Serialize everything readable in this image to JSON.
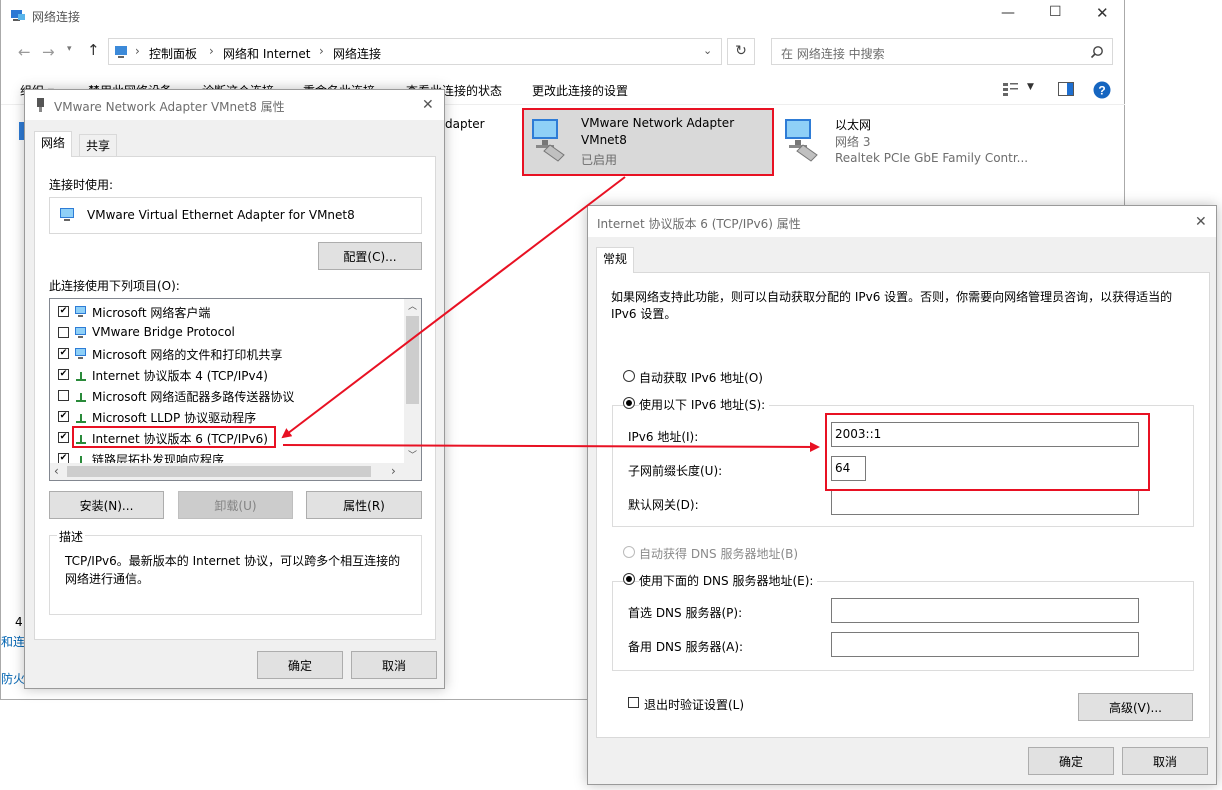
{
  "explorer": {
    "title": "网络连接",
    "breadcrumb": [
      "控制面板",
      "网络和 Internet",
      "网络连接"
    ],
    "search_placeholder": "在 网络连接 中搜索",
    "commands": [
      "组织 ▾",
      "禁用此网络设备",
      "诊断这个连接",
      "重命名此连接",
      "查看此连接的状态",
      "更改此连接的设置"
    ],
    "items": [
      {
        "name": "VMware Network Adapter VMnet8",
        "line1": "VMware Network Adapter",
        "line2": "VMnet8",
        "status": "已启用"
      },
      {
        "name": "以太网",
        "line1": "以太网",
        "line2": "网络 3",
        "status": "Realtek PCIe GbE Family Contr..."
      }
    ],
    "partial_item": "dapter",
    "left_fragments": [
      "4",
      "和连",
      "防火"
    ]
  },
  "props": {
    "title": "VMware Network Adapter VMnet8 属性",
    "tabs": [
      "网络",
      "共享"
    ],
    "connect_label": "连接时使用:",
    "adapter": "VMware Virtual Ethernet Adapter for VMnet8",
    "configure": "配置(C)...",
    "items_label": "此连接使用下列项目(O):",
    "components": [
      {
        "label": "Microsoft 网络客户端",
        "checked": true
      },
      {
        "label": "VMware Bridge Protocol",
        "checked": false
      },
      {
        "label": "Microsoft 网络的文件和打印机共享",
        "checked": true
      },
      {
        "label": "Internet 协议版本 4 (TCP/IPv4)",
        "checked": true
      },
      {
        "label": "Microsoft 网络适配器多路传送器协议",
        "checked": false
      },
      {
        "label": "Microsoft LLDP 协议驱动程序",
        "checked": true
      },
      {
        "label": "Internet 协议版本 6 (TCP/IPv6)",
        "checked": true
      },
      {
        "label": "链路层拓扑发现响应程序",
        "checked": true
      }
    ],
    "install": "安装(N)...",
    "uninstall": "卸载(U)",
    "properties": "属性(R)",
    "desc_label": "描述",
    "desc": "TCP/IPv6。最新版本的 Internet 协议，可以跨多个相互连接的网络进行通信。",
    "ok": "确定",
    "cancel": "取消"
  },
  "ipv6": {
    "title": "Internet 协议版本 6 (TCP/IPv6) 属性",
    "tab": "常规",
    "intro": "如果网络支持此功能，则可以自动获取分配的 IPv6 设置。否则，你需要向网络管理员咨询，以获得适当的 IPv6 设置。",
    "auto_ip": "自动获取 IPv6 地址(O)",
    "use_ip": "使用以下 IPv6 地址(S):",
    "ip_label": "IPv6 地址(I):",
    "ip_value": "2003::1",
    "prefix_label": "子网前缀长度(U):",
    "prefix_value": "64",
    "gateway_label": "默认网关(D):",
    "gateway_value": "",
    "auto_dns": "自动获得 DNS 服务器地址(B)",
    "use_dns": "使用下面的 DNS 服务器地址(E):",
    "dns1_label": "首选 DNS 服务器(P):",
    "dns2_label": "备用 DNS 服务器(A):",
    "validate": "退出时验证设置(L)",
    "advanced": "高级(V)...",
    "ok": "确定",
    "cancel": "取消"
  },
  "colors": {
    "highlight": "#e81123",
    "arrow": "#e81123",
    "link": "#0063b1"
  }
}
